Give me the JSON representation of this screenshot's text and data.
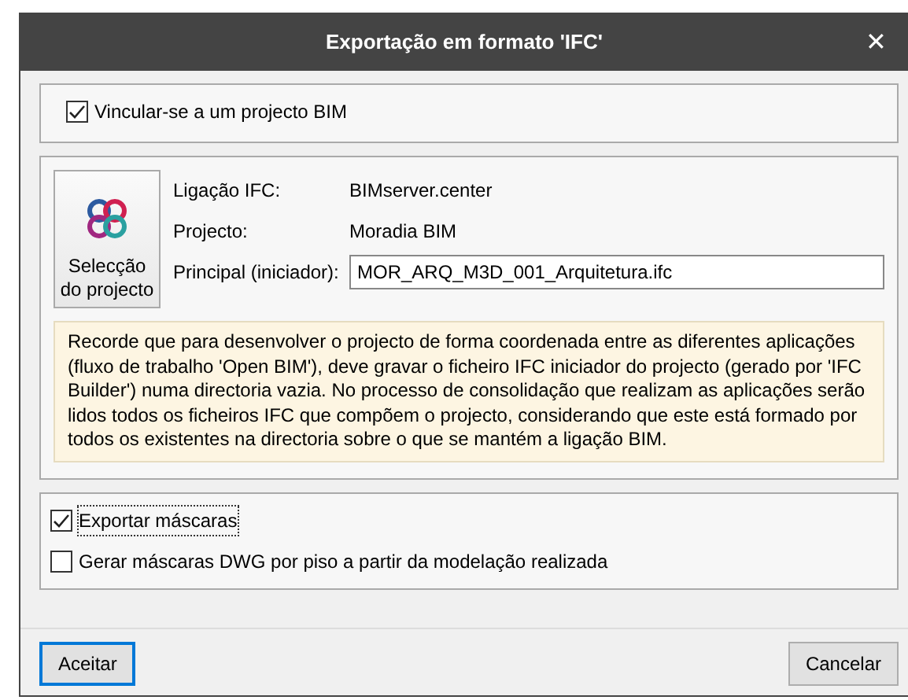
{
  "window": {
    "title": "Exportação em formato 'IFC'",
    "close": "✕"
  },
  "link_bim": {
    "label": "Vincular-se a um projecto BIM",
    "checked": true
  },
  "project_button": {
    "label": "Selecção do projecto"
  },
  "fields": [
    {
      "label": "Ligação IFC:",
      "value": "BIMserver.center",
      "kind": "text"
    },
    {
      "label": "Projecto:",
      "value": "Moradia BIM",
      "kind": "text"
    },
    {
      "label": "Principal (iniciador):",
      "value": "MOR_ARQ_M3D_001_Arquitetura.ifc",
      "kind": "input"
    }
  ],
  "note": "Recorde que para desenvolver o projecto de forma coordenada entre as diferentes aplicações (fluxo de trabalho 'Open BIM'), deve gravar o ficheiro IFC iniciador do projecto (gerado por 'IFC Builder') numa directoria vazia. No processo de consolidação que realizam as aplicações serão lidos todos os ficheiros IFC que compõem o projecto, considerando que este está formado por todos os existentes na directoria sobre o que se mantém a ligação BIM.",
  "options": [
    {
      "label": "Exportar máscaras",
      "checked": true,
      "focused": true
    },
    {
      "label": "Gerar máscaras DWG por piso a partir da modelação realizada",
      "checked": false,
      "focused": false
    }
  ],
  "buttons": [
    {
      "label": "Aceitar",
      "default": true
    },
    {
      "label": "Cancelar",
      "default": false
    }
  ]
}
